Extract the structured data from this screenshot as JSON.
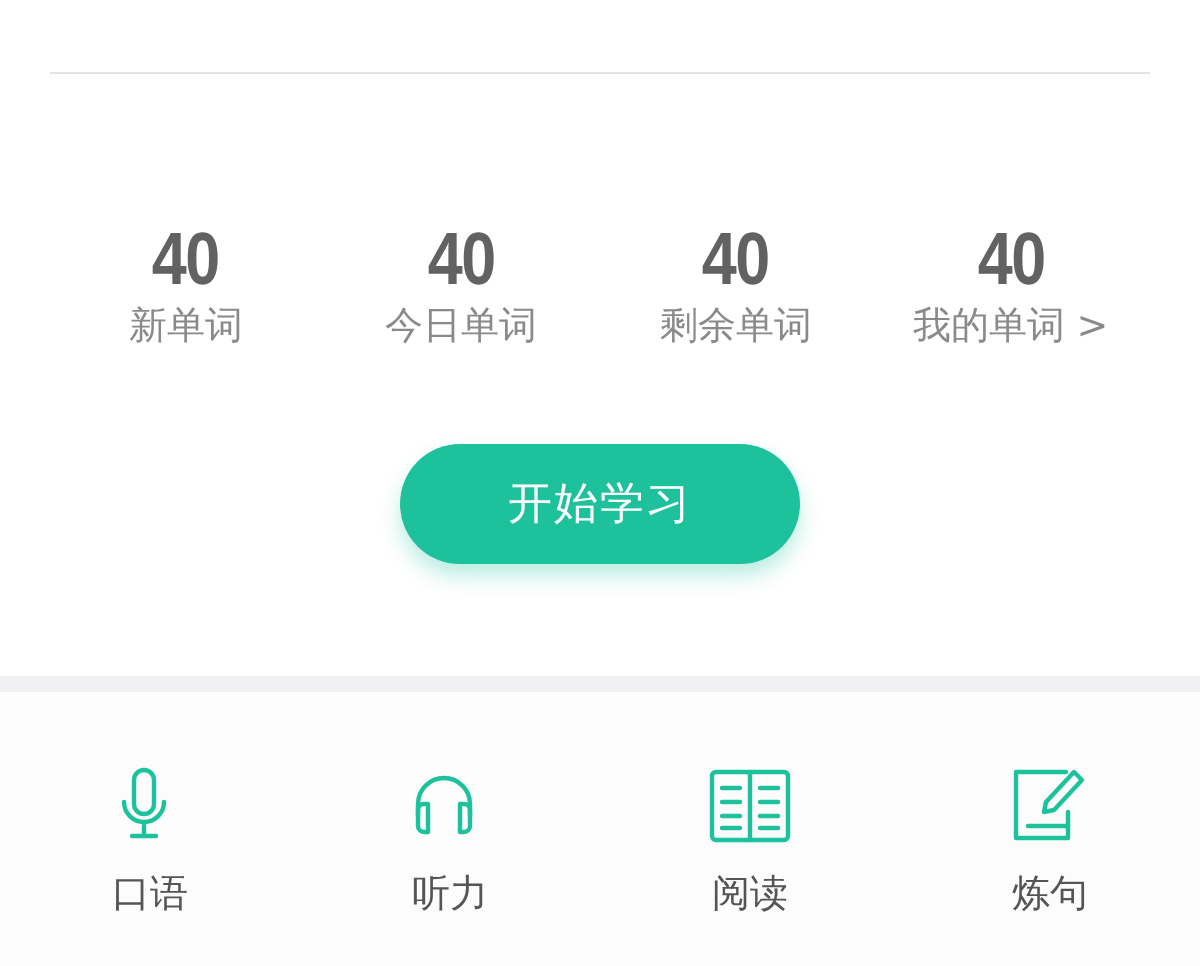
{
  "stats": [
    {
      "value": "40",
      "label": "新单词"
    },
    {
      "value": "40",
      "label": "今日单词"
    },
    {
      "value": "40",
      "label": "剩余单词"
    },
    {
      "value": "40",
      "label": "我的单词 >"
    }
  ],
  "start_button": {
    "label": "开始学习"
  },
  "features": [
    {
      "kind": "microphone",
      "label": "口语"
    },
    {
      "kind": "headphones",
      "label": "听力"
    },
    {
      "kind": "book",
      "label": "阅读"
    },
    {
      "kind": "note",
      "label": "炼句"
    }
  ]
}
